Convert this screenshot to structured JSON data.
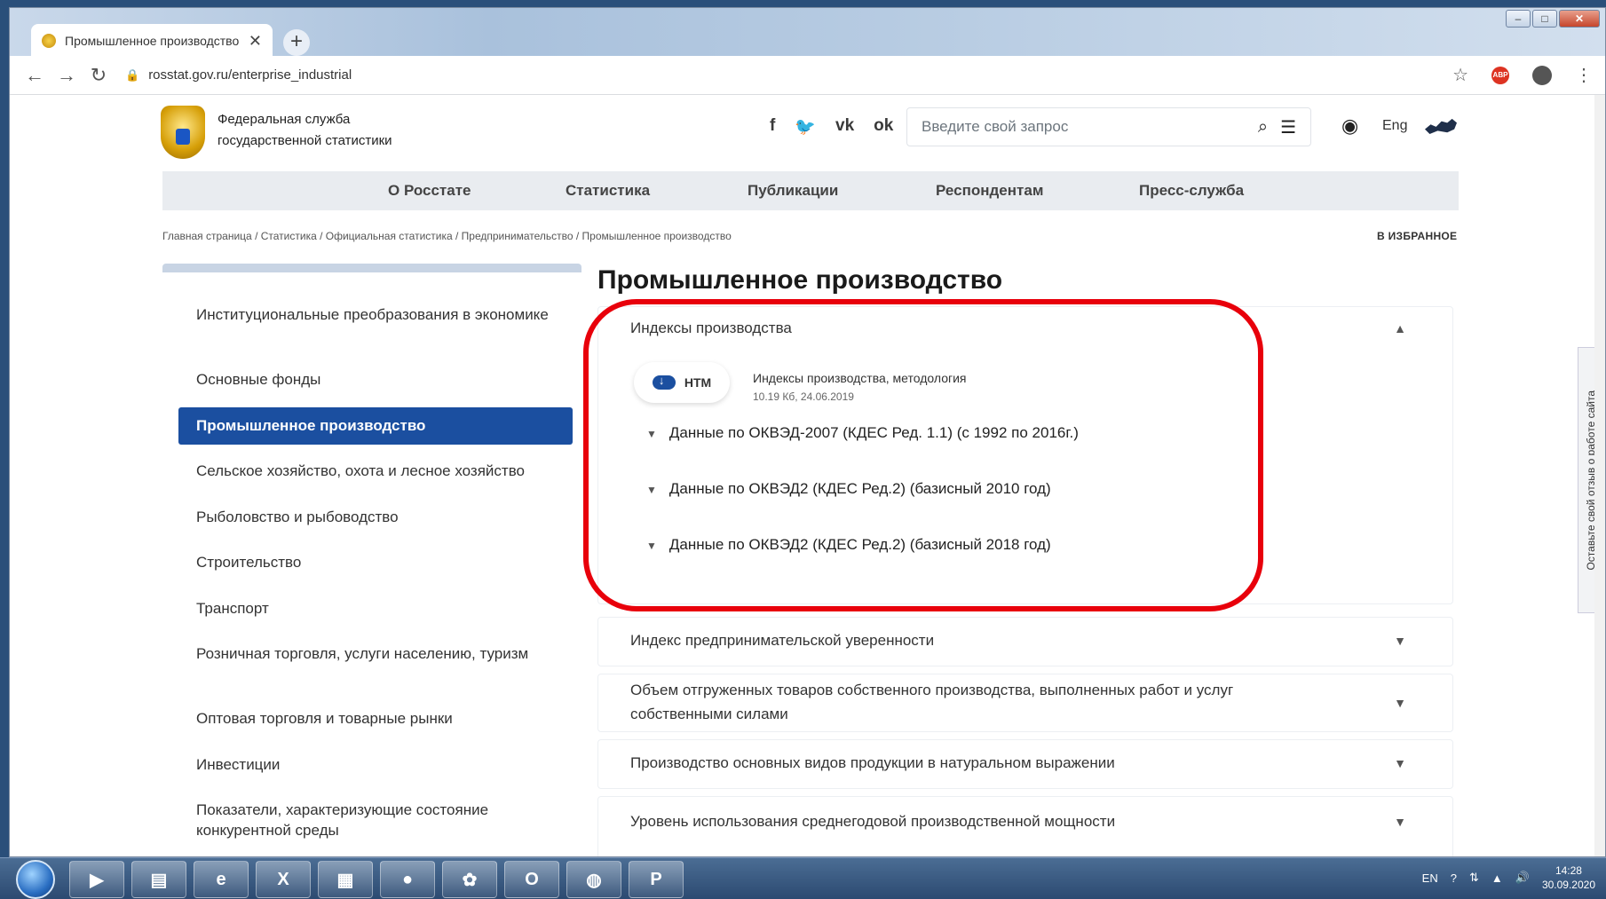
{
  "browser": {
    "tab_title": "Промышленное производство",
    "tab_close": "✕",
    "new_tab": "+",
    "url": "rosstat.gov.ru/enterprise_industrial"
  },
  "header": {
    "org_line1": "Федеральная служба",
    "org_line2": "государственной статистики",
    "social": [
      "f",
      "🐦",
      "vk",
      "ok"
    ],
    "search_placeholder": "Введите свой запрос",
    "lang": "Eng"
  },
  "menu": [
    "О Росстате",
    "Статистика",
    "Публикации",
    "Респондентам",
    "Пресс-служба"
  ],
  "breadcrumb": "Главная страница / Статистика / Официальная статистика / Предпринимательство / Промышленное производство",
  "favorites": "В ИЗБРАННОЕ",
  "sidebar": {
    "items": [
      "Институциональные преобразования в экономике",
      "Основные фонды",
      "Промышленное производство",
      "Сельское хозяйство, охота и лесное хозяйство",
      "Рыболовство и рыбоводство",
      "Строительство",
      "Транспорт",
      "Розничная торговля, услуги населению, туризм",
      "Оптовая торговля и товарные рынки",
      "Инвестиции",
      "Показатели, характеризующие состояние конкурентной среды"
    ],
    "active_index": 2
  },
  "main": {
    "title": "Промышленное производство",
    "panels": [
      {
        "title": "Индексы производства",
        "expanded": true,
        "file_button": "HTM",
        "doc_title": "Индексы производства, методология",
        "doc_meta": "10.19 Кб, 24.06.2019",
        "subitems": [
          "Данные по ОКВЭД-2007 (КДЕС Ред. 1.1) (с 1992 по 2016г.)",
          "Данные по ОКВЭД2 (КДЕС Ред.2) (базисный 2010 год)",
          "Данные по ОКВЭД2 (КДЕС Ред.2) (базисный 2018 год)"
        ]
      },
      {
        "title": "Индекс предпринимательской уверенности"
      },
      {
        "title": "Объем отгруженных товаров собственного производства, выполненных работ и услуг собственными силами"
      },
      {
        "title": "Производство основных видов продукции в натуральном выражении"
      },
      {
        "title": "Уровень использования среднегодовой производственной мощности"
      }
    ]
  },
  "feedback_tab": "Оставьте свой отзыв о работе сайта",
  "taskbar": {
    "lang": "EN",
    "time": "14:28",
    "date": "30.09.2020"
  },
  "colors": {
    "accent": "#1b4fa0",
    "highlight": "#e8000b"
  }
}
